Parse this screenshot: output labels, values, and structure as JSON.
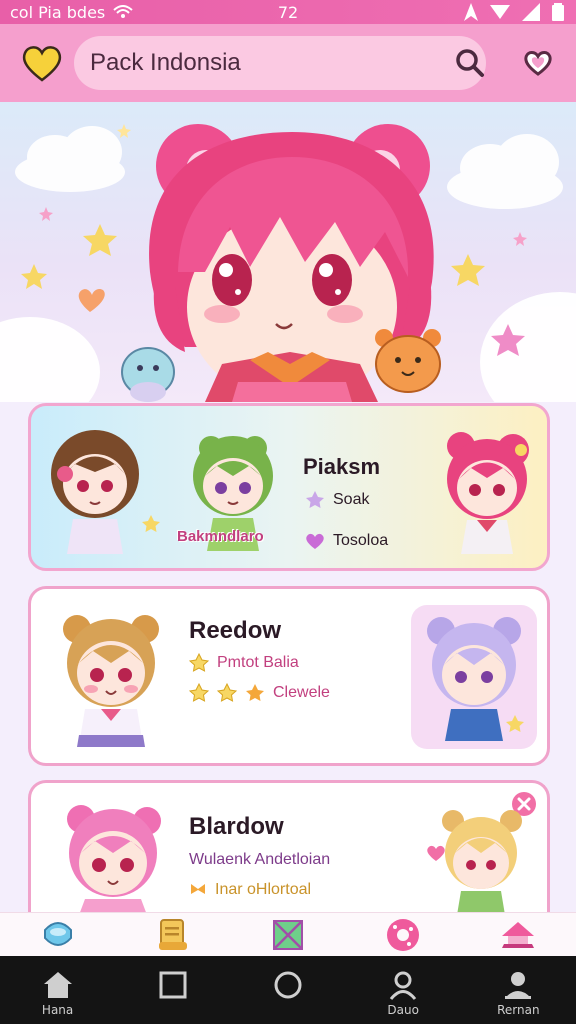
{
  "status_bar": {
    "carrier": "col Pia bdes",
    "time": "72"
  },
  "app_bar": {
    "title": "Pack Indonsia",
    "icons": [
      "heart-icon",
      "search-icon",
      "heart-outline-icon"
    ]
  },
  "colors": {
    "accent": "#ef6fb3",
    "app_bar": "#f59fcd",
    "nav": "#141414",
    "meta_pink": "#c2407f",
    "meta_purple": "#7d3b8a"
  },
  "cards": [
    {
      "title": "Piaksm",
      "badge": "Bakmndlaro",
      "meta": [
        {
          "icon": "star-icon",
          "text": "Soak"
        },
        {
          "icon": "heart-icon",
          "text": "Tosoloa"
        }
      ]
    },
    {
      "title": "Reedow",
      "meta": [
        {
          "icon": "star-icon",
          "text": "Pmtot Balia"
        },
        {
          "icon": "star-icon",
          "text": "Clewele"
        }
      ]
    },
    {
      "title": "Blardow",
      "meta": [
        {
          "icon": "",
          "text": "Wulaenk Andetloian"
        },
        {
          "icon": "ribbon-icon",
          "text": "Inar oHlortoal"
        }
      ]
    }
  ],
  "tab_bar": {
    "items": [
      "gem-icon",
      "scroll-icon",
      "map-icon",
      "donut-icon",
      "home-roof-icon"
    ]
  },
  "nav_bar": {
    "items": [
      {
        "icon": "home-icon",
        "label": "Hana"
      },
      {
        "icon": "square-icon",
        "label": ""
      },
      {
        "icon": "circle-icon",
        "label": ""
      },
      {
        "icon": "person-icon",
        "label": "Dauo"
      },
      {
        "icon": "person-icon",
        "label": "Rernan"
      }
    ]
  }
}
